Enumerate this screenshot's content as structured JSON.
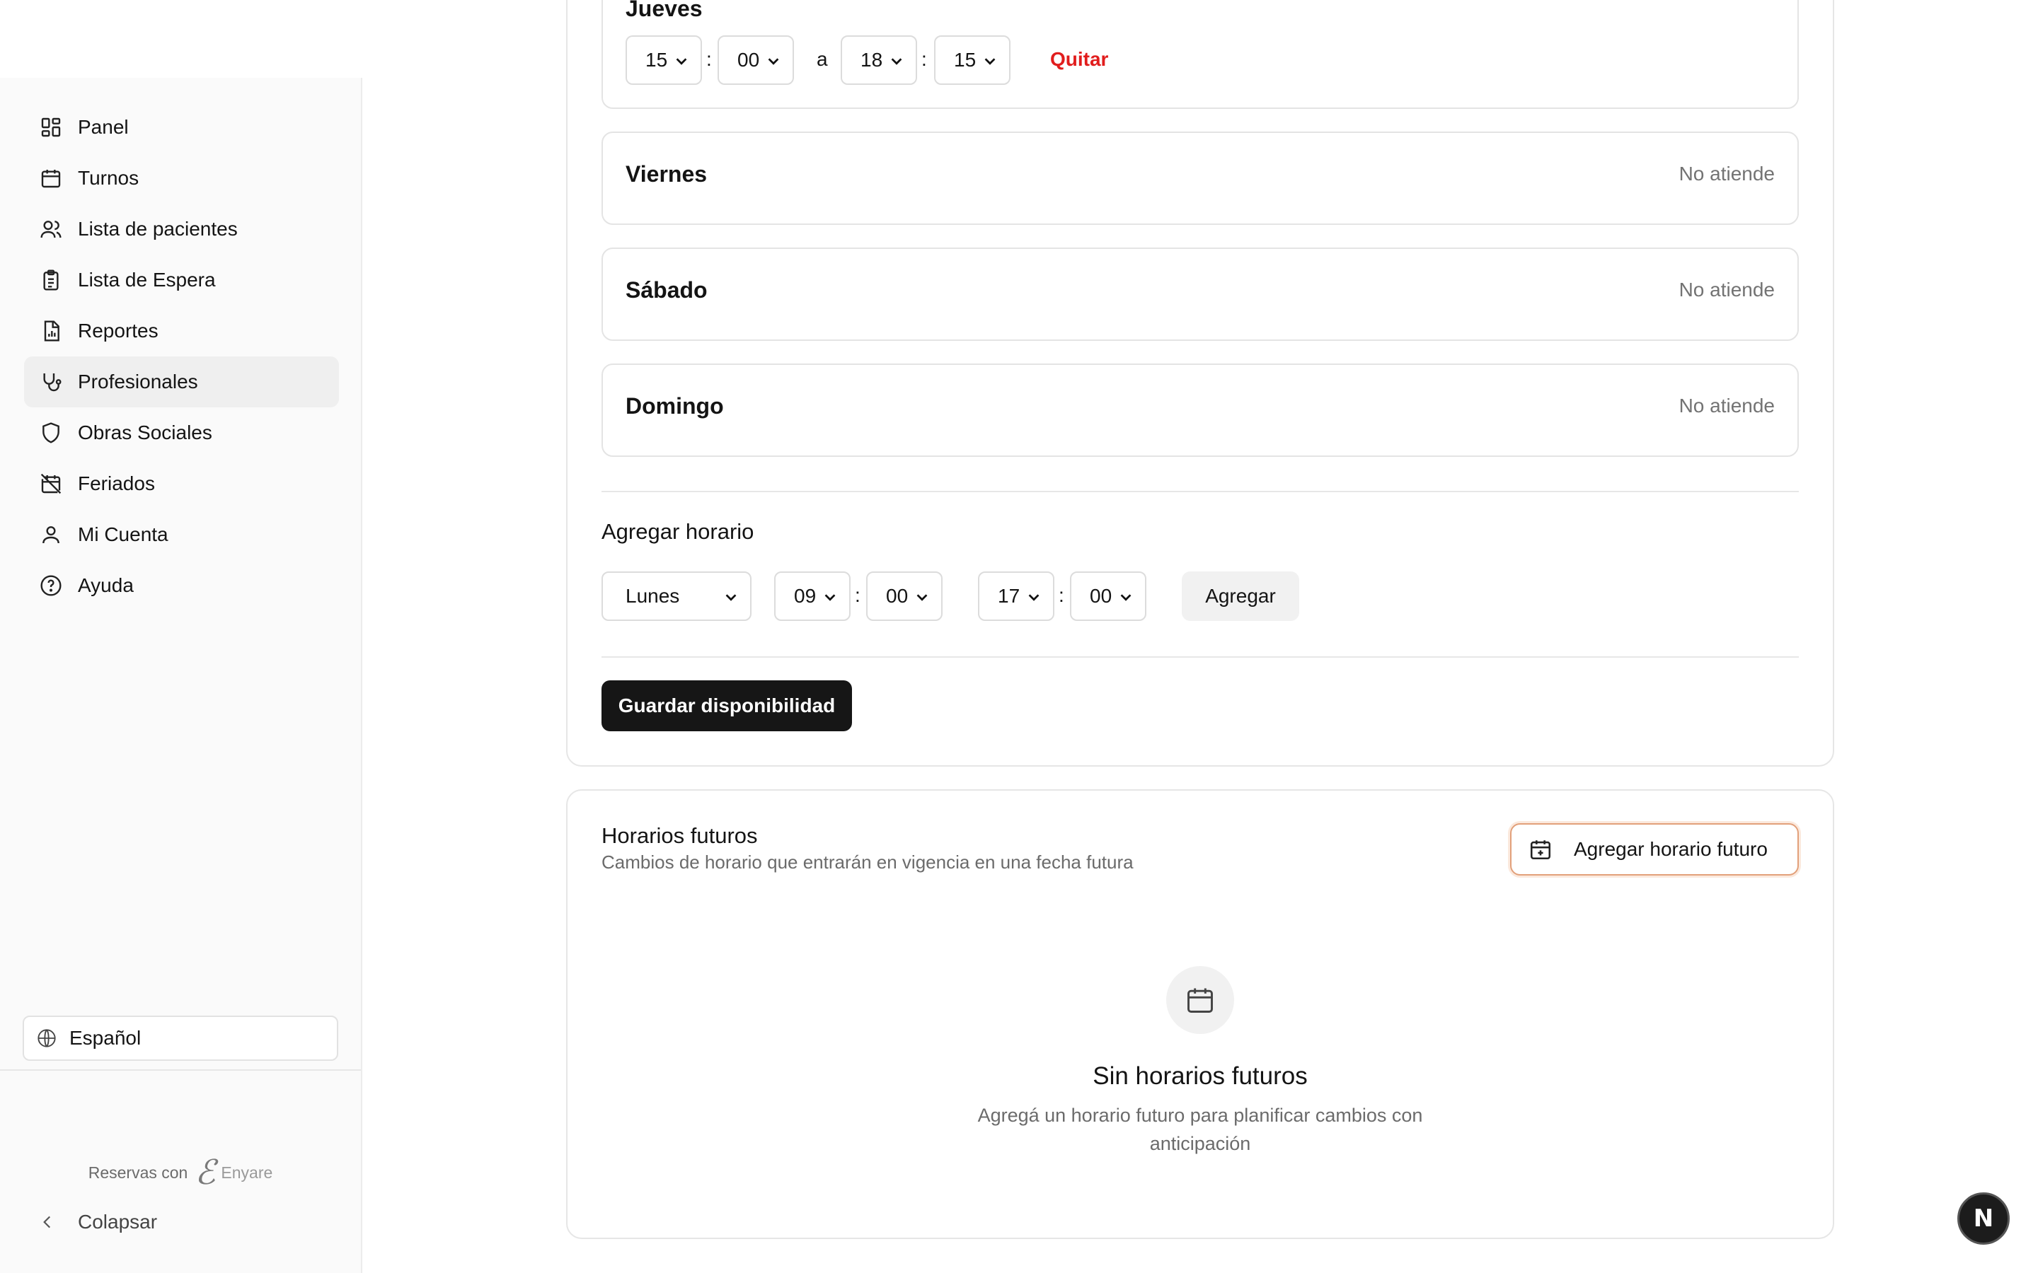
{
  "sidebar": {
    "items": [
      {
        "label": "Panel",
        "icon": "dashboard-grid-icon"
      },
      {
        "label": "Turnos",
        "icon": "calendar-icon"
      },
      {
        "label": "Lista de pacientes",
        "icon": "users-icon"
      },
      {
        "label": "Lista de Espera",
        "icon": "clipboard-list-icon"
      },
      {
        "label": "Reportes",
        "icon": "file-chart-icon"
      },
      {
        "label": "Profesionales",
        "icon": "stethoscope-icon",
        "active": true
      },
      {
        "label": "Obras Sociales",
        "icon": "shield-icon"
      },
      {
        "label": "Feriados",
        "icon": "calendar-off-icon"
      },
      {
        "label": "Mi Cuenta",
        "icon": "user-icon"
      },
      {
        "label": "Ayuda",
        "icon": "help-circle-icon"
      }
    ],
    "language": "Español",
    "powered_by": "Reservas con",
    "brand": "Enyare",
    "collapse_label": "Colapsar"
  },
  "availability": {
    "thursday": {
      "name": "Jueves",
      "start_hour": "15",
      "start_minute": "00",
      "separator": "a",
      "end_hour": "18",
      "end_minute": "15",
      "remove_label": "Quitar"
    },
    "days": [
      {
        "name": "Viernes",
        "status": "No atiende"
      },
      {
        "name": "Sábado",
        "status": "No atiende"
      },
      {
        "name": "Domingo",
        "status": "No atiende"
      }
    ],
    "add_schedule": {
      "title": "Agregar horario",
      "day": "Lunes",
      "start_hour": "09",
      "start_minute": "00",
      "end_hour": "17",
      "end_minute": "00",
      "add_label": "Agregar"
    },
    "save_label": "Guardar disponibilidad"
  },
  "future": {
    "title": "Horarios futuros",
    "subtitle": "Cambios de horario que entrarán en vigencia en una fecha futura",
    "add_label": "Agregar horario futuro",
    "empty_title": "Sin horarios futuros",
    "empty_desc_line1": "Agregá un horario futuro para planificar cambios con",
    "empty_desc_line2": "anticipación"
  },
  "colors": {
    "accent_danger": "#e11d1d",
    "primary_button": "#161616",
    "outline_accent": "#e2a07a"
  },
  "fab_label": "N"
}
